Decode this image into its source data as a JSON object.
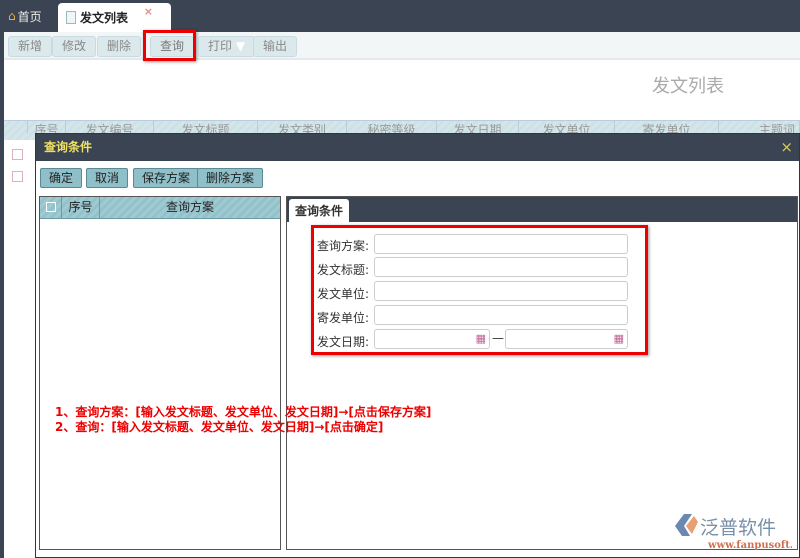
{
  "tabs": [
    {
      "label": "首页",
      "icon": "home-icon"
    },
    {
      "label": "发文列表",
      "icon": "document-icon",
      "close": "×"
    }
  ],
  "toolbar": {
    "add": "新增",
    "edit": "修改",
    "delete": "删除",
    "query": "查询",
    "print": "打印",
    "export": "输出"
  },
  "page_title": "发文列表",
  "grid": {
    "columns": [
      "序号",
      "发文编号",
      "发文标题",
      "发文类别",
      "秘密等级",
      "发文日期",
      "发文单位",
      "寄发单位",
      "主题词"
    ]
  },
  "dialog": {
    "title": "查询条件",
    "close": "×",
    "buttons": {
      "ok": "确定",
      "cancel": "取消",
      "save_scheme": "保存方案",
      "delete_scheme": "删除方案"
    },
    "scheme_list": {
      "columns": [
        "序号",
        "查询方案"
      ]
    },
    "form_tab": "查询条件",
    "fields": [
      {
        "label": "查询方案:",
        "value": ""
      },
      {
        "label": "发文标题:",
        "value": ""
      },
      {
        "label": "发文单位:",
        "value": ""
      },
      {
        "label": "寄发单位:",
        "value": ""
      }
    ],
    "date_label": "发文日期:",
    "date_sep": "—",
    "date_from": "",
    "date_to": ""
  },
  "notes": [
    "1、查询方案：[输入发文标题、发文单位、发文日期]→[点击保存方案]",
    "2、查询：[输入发文标题、发文单位、发文日期]→[点击确定]"
  ],
  "logo": {
    "name": "泛普软件",
    "url": "www.fanpusoft.com"
  },
  "colors": {
    "accent": "#e00000",
    "dark": "#3b4452",
    "title": "#f0e060"
  }
}
